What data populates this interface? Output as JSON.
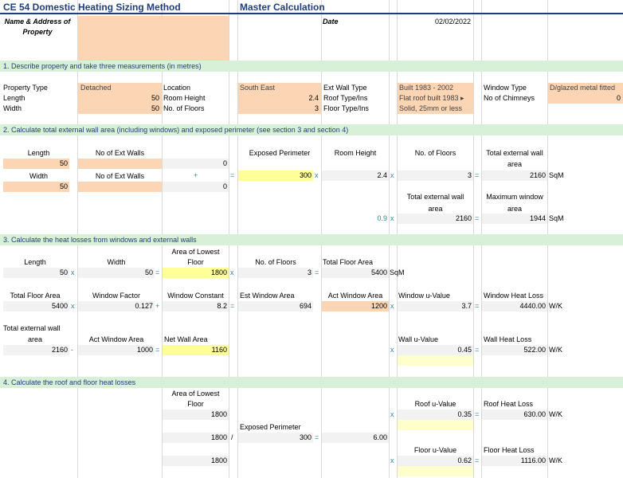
{
  "header": {
    "title": "CE 54 Domestic Heating Sizing Method",
    "subtitle": "Master Calculation",
    "name_label": "Name & Address of Property",
    "date_label": "Date",
    "date_value": "02/02/2022"
  },
  "sections": {
    "s1": "1. Describe property and take three measurements (in metres)",
    "s2": "2. Calculate total external wall area (including windows) and exposed perimeter (see section 3 and section 4)",
    "s3": "3. Calculate the heat losses from windows and external walls",
    "s4": "4. Calculate the roof and floor heat losses"
  },
  "s1": {
    "property_type_label": "Property Type",
    "property_type": "Detached",
    "length_label": "Length",
    "length": "50",
    "width_label": "Width",
    "width": "50",
    "location_label": "Location",
    "location": "South East",
    "room_height_label": "Room Height",
    "room_height": "2.4",
    "floors_label": "No. of Floors",
    "floors": "3",
    "ext_wall_label": "Ext Wall Type",
    "ext_wall": "Built 1983 - 2002",
    "roof_label": "Roof Type/Ins",
    "roof": "Flat roof built 1983 ▸",
    "floor_label": "Floor Type/Ins",
    "floor": "Solid, 25mm or less",
    "window_type_label": "Window Type",
    "window_type": "D/glazed metal fitted",
    "chimneys_label": "No of Chimneys",
    "chimneys": "0"
  },
  "s2": {
    "length_label": "Length",
    "length": "50",
    "ext_walls_label1": "No of Ext Walls",
    "ext_walls1": "0",
    "width_label": "Width",
    "width": "50",
    "ext_walls_label2": "No of Ext Walls",
    "ext_walls2": "0",
    "exposed_perimeter_label": "Exposed Perimeter",
    "exposed_perimeter": "300",
    "room_height_label": "Room Height",
    "room_height": "2.4",
    "floors_label": "No. of Floors",
    "floors": "3",
    "total_ext_wall_label_a": "Total external wall",
    "total_ext_wall_label_b": "area",
    "total_ext_wall_area": "2160",
    "sqm": "SqM",
    "factor": "0.9",
    "total_ext_wall_label2_a": "Total external wall",
    "total_ext_wall_label2_b": "area",
    "total_ext_wall_area2": "2160",
    "max_window_label_a": "Maximum window",
    "max_window_label_b": "area",
    "max_window_area": "1944"
  },
  "s3": {
    "length_label": "Length",
    "length": "50",
    "width_label": "Width",
    "width": "50",
    "lowest_floor_label_a": "Area of Lowest",
    "lowest_floor_label_b": "Floor",
    "lowest_floor": "1800",
    "floors_label": "No. of Floors",
    "floors": "3",
    "total_floor_label": "Total Floor Area",
    "total_floor": "5400",
    "sqm": "SqM",
    "tfa_label2": "Total Floor Area",
    "tfa2": "5400",
    "window_factor_label": "Window Factor",
    "window_factor": "0.127",
    "window_constant_label": "Window Constant",
    "window_constant": "8.2",
    "est_window_label": "Est Window Area",
    "est_window": "694",
    "act_window_label": "Act Window Area",
    "act_window": "1200",
    "window_u_label": "Window u-Value",
    "window_u": "3.7",
    "window_loss_label": "Window Heat Loss",
    "window_loss": "4440.00",
    "wk": "W/K",
    "tewa_label_a": "Total external wall",
    "tewa_label_b": "area",
    "tewa": "2160",
    "act_window_label2": "Act Window Area",
    "act_window2": "1000",
    "net_wall_label": "Net Wall Area",
    "net_wall": "1160",
    "wall_u_label": "Wall u-Value",
    "wall_u": "0.45",
    "wall_loss_label": "Wall Heat Loss",
    "wall_loss": "522.00"
  },
  "s4": {
    "lowest_floor_label_a": "Area of Lowest",
    "lowest_floor_label_b": "Floor",
    "lowest_floor": "1800",
    "roof_u_label": "Roof u-Value",
    "roof_u": "0.35",
    "roof_loss_label": "Roof Heat Loss",
    "roof_loss": "630.00",
    "lowest_floor2": "1800",
    "exposed_perimeter_label": "Exposed Perimeter",
    "exposed_perimeter": "300",
    "ratio": "6.00",
    "lowest_floor3": "1800",
    "floor_u_label": "Floor u-Value",
    "floor_u": "0.62",
    "floor_loss_label": "Floor Heat Loss",
    "floor_loss": "1116.00",
    "wk": "W/K"
  },
  "ops": {
    "x": "x",
    "eq": "=",
    "plus": "+",
    "minus": "-",
    "div": "/"
  },
  "colors": {
    "orange": "#fcd5b4",
    "yellow": "#ffff99",
    "band": "#d8f0d8",
    "title": "#1f3d7a"
  }
}
